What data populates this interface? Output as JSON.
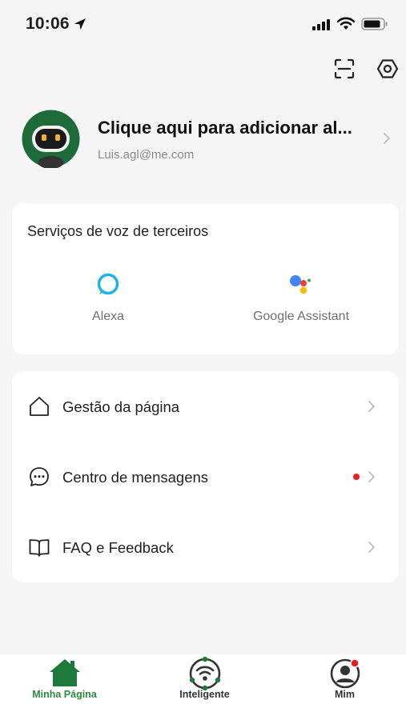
{
  "status_bar": {
    "time": "10:06"
  },
  "profile": {
    "name": "Clique aqui para adicionar al...",
    "email": "Luis.agl@me.com"
  },
  "voice_services": {
    "title": "Serviços de voz de terceiros",
    "items": [
      {
        "label": "Alexa",
        "icon": "alexa-icon"
      },
      {
        "label": "Google Assistant",
        "icon": "google-assistant-icon"
      }
    ]
  },
  "menu": {
    "items": [
      {
        "label": "Gestão da página",
        "icon": "home-outline-icon",
        "has_dot": false
      },
      {
        "label": "Centro de mensagens",
        "icon": "message-icon",
        "has_dot": true
      },
      {
        "label": "FAQ e Feedback",
        "icon": "book-icon",
        "has_dot": false
      }
    ]
  },
  "tab_bar": {
    "tabs": [
      {
        "label": "Minha Página",
        "icon": "home-icon",
        "active": true
      },
      {
        "label": "Inteligente",
        "icon": "smart-icon",
        "active": false
      },
      {
        "label": "Mim",
        "icon": "profile-icon",
        "active": false
      }
    ]
  },
  "colors": {
    "accent": "#2b8a3e",
    "background": "#f5f5f5",
    "card": "#ffffff",
    "notification_dot": "#ee1c1c"
  }
}
